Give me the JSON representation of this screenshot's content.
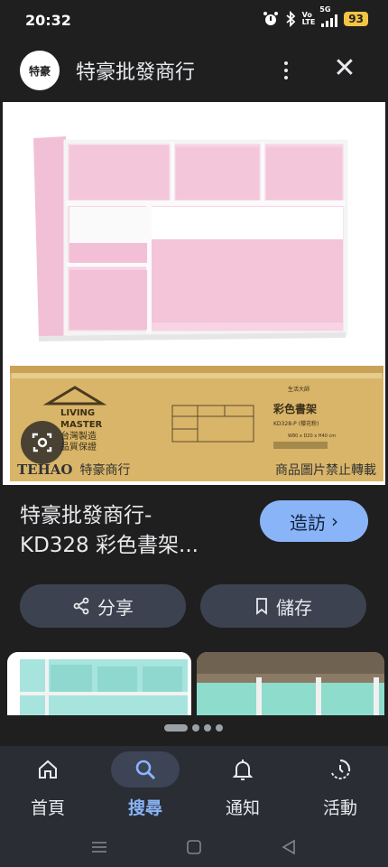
{
  "status_bar": {
    "time": "20:32",
    "net_top": "Vo",
    "net_bottom": "LTE",
    "net_5g": "5G",
    "battery": "93"
  },
  "header": {
    "logo_text": "特豪",
    "site_name": "特豪批發商行"
  },
  "image": {
    "watermark_brand": "TEHAO",
    "watermark_name": "特豪商行",
    "watermark_notice": "商品圖片禁止轉載",
    "box_brand_line1": "LIVING",
    "box_brand_line2": "MASTER",
    "box_made_line1": "台灣製造",
    "box_made_line2": "品質保證",
    "box_product_name": "彩色書架",
    "box_model": "KD328-P (櫻花粉)",
    "box_dimensions": "W80 x D20 x H40 cm",
    "box_logo": "生活大師"
  },
  "result": {
    "title_line1": "特豪批發商行-",
    "title_line2": "KD328 彩色書架...",
    "visit_label": "造訪"
  },
  "actions": {
    "share_label": "分享",
    "save_label": "儲存"
  },
  "nav": {
    "home": "首頁",
    "search": "搜尋",
    "notifications": "通知",
    "activity": "活動"
  },
  "colors": {
    "accent": "#8ab4f8",
    "background": "#1f1f1f",
    "button_bg": "#3c4250",
    "shelf_pink": "#f6cfe0",
    "shelf_teal": "#9fe1da"
  }
}
